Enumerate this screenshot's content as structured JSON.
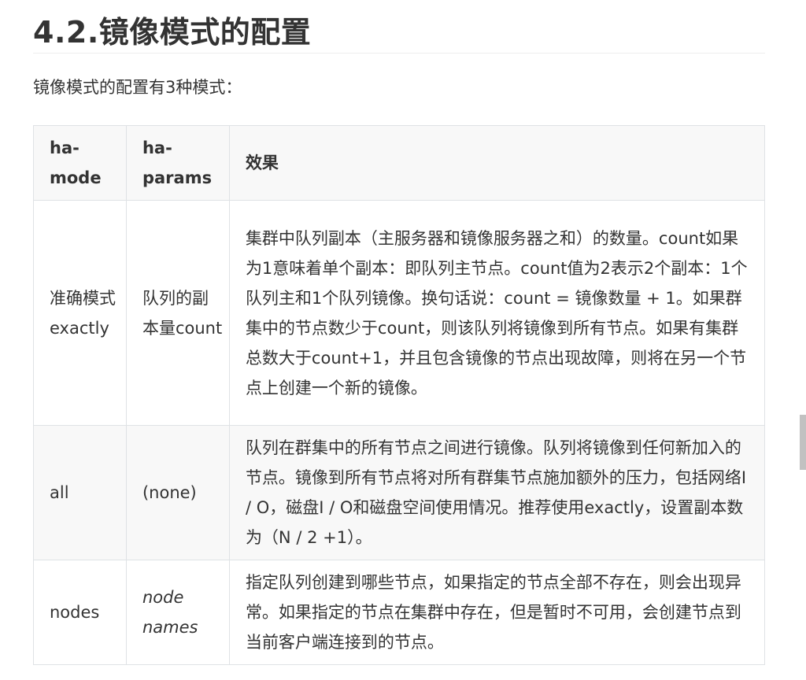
{
  "heading": "4.2.镜像模式的配置",
  "intro": "镜像模式的配置有3种模式：",
  "table": {
    "headers": [
      "ha-mode",
      "ha-params",
      "效果"
    ],
    "rows": [
      {
        "mode": "准确模式exactly",
        "params": "队列的副本量count",
        "params_italic": false,
        "effect": "集群中队列副本（主服务器和镜像服务器之和）的数量。count如果为1意味着单个副本：即队列主节点。count值为2表示2个副本：1个队列主和1个队列镜像。换句话说：count = 镜像数量 + 1。如果群集中的节点数少于count，则该队列将镜像到所有节点。如果有集群总数大于count+1，并且包含镜像的节点出现故障，则将在另一个节点上创建一个新的镜像。"
      },
      {
        "mode": "all",
        "params": "(none)",
        "params_italic": false,
        "effect": "队列在群集中的所有节点之间进行镜像。队列将镜像到任何新加入的节点。镜像到所有节点将对所有群集节点施加额外的压力，包括网络I / O，磁盘I / O和磁盘空间使用情况。推荐使用exactly，设置副本数为（N / 2 +1）。"
      },
      {
        "mode": "nodes",
        "params": "node names",
        "params_italic": true,
        "effect": "指定队列创建到哪些节点，如果指定的节点全部不存在，则会出现异常。如果指定的节点在集群中存在，但是暂时不可用，会创建节点到当前客户端连接到的节点。"
      }
    ]
  }
}
